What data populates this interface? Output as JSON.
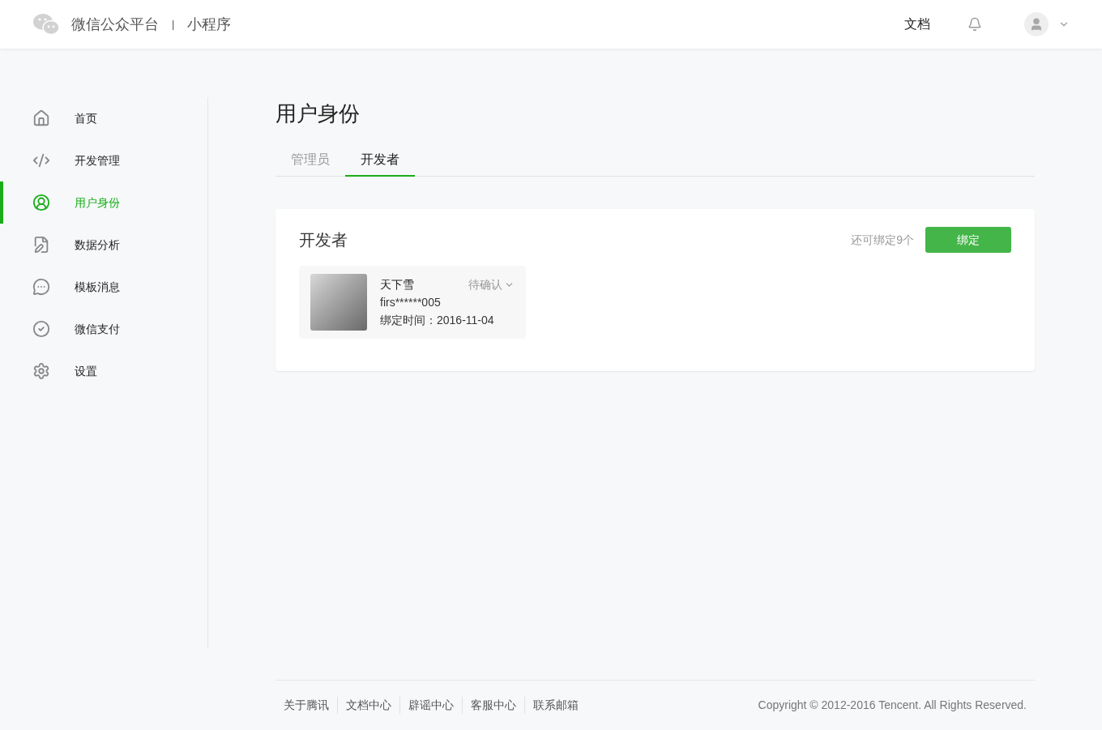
{
  "header": {
    "brand": "微信公众平台",
    "separator": "|",
    "product": "小程序",
    "docs_link": "文档"
  },
  "sidebar": {
    "items": [
      {
        "kind": "home",
        "label": "首页",
        "selected": false
      },
      {
        "kind": "code",
        "label": "开发管理",
        "selected": false
      },
      {
        "kind": "user",
        "label": "用户身份",
        "selected": true
      },
      {
        "kind": "report",
        "label": "数据分析",
        "selected": false
      },
      {
        "kind": "message",
        "label": "模板消息",
        "selected": false
      },
      {
        "kind": "pay",
        "label": "微信支付",
        "selected": false
      },
      {
        "kind": "settings",
        "label": "设置",
        "selected": false
      }
    ]
  },
  "page": {
    "title": "用户身份",
    "tabs": [
      {
        "label": "管理员",
        "selected": false
      },
      {
        "label": "开发者",
        "selected": true
      }
    ]
  },
  "panel": {
    "title": "开发者",
    "remaining": "还可绑定9个",
    "bind_button": "绑定",
    "members": [
      {
        "name": "天下雪",
        "account": "firs******005",
        "bind_time": "绑定时间：2016-11-04",
        "status": "待确认"
      }
    ]
  },
  "footer": {
    "links": [
      "关于腾讯",
      "文档中心",
      "辟谣中心",
      "客服中心",
      "联系邮箱"
    ],
    "copyright": "Copyright © 2012-2016 Tencent. All Rights Reserved."
  }
}
